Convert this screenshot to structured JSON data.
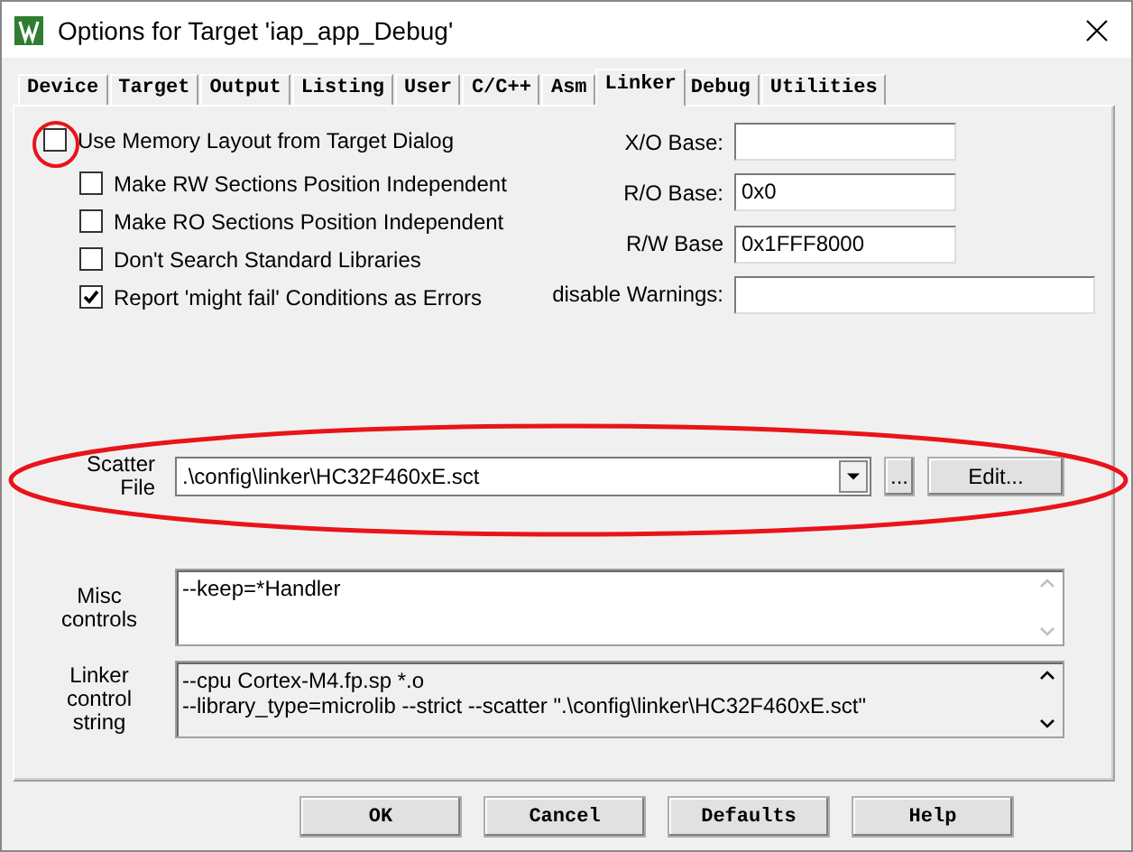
{
  "window": {
    "title": "Options for Target 'iap_app_Debug'"
  },
  "tabs": [
    {
      "label": "Device",
      "selected": false
    },
    {
      "label": "Target",
      "selected": false
    },
    {
      "label": "Output",
      "selected": false
    },
    {
      "label": "Listing",
      "selected": false
    },
    {
      "label": "User",
      "selected": false
    },
    {
      "label": "C/C++",
      "selected": false
    },
    {
      "label": "Asm",
      "selected": false
    },
    {
      "label": "Linker",
      "selected": true
    },
    {
      "label": "Debug",
      "selected": false
    },
    {
      "label": "Utilities",
      "selected": false
    }
  ],
  "checkboxes": [
    {
      "kind": "main",
      "label": "Use Memory Layout from Target Dialog",
      "checked": false
    },
    {
      "kind": "sub",
      "label": "Make RW Sections Position Independent",
      "checked": false
    },
    {
      "kind": "sub",
      "label": "Make RO Sections Position Independent",
      "checked": false
    },
    {
      "kind": "sub",
      "label": "Don't Search Standard Libraries",
      "checked": false
    },
    {
      "kind": "sub",
      "label": "Report 'might fail' Conditions as Errors",
      "checked": true
    }
  ],
  "address_fields": [
    {
      "kind": "short",
      "label": "X/O Base:"
    },
    {
      "kind": "short",
      "label": "R/O Base:",
      "value": "0x0"
    },
    {
      "kind": "short",
      "label": "R/W Base",
      "value": "0x1FFF8000"
    },
    {
      "kind": "wide",
      "label": "disable Warnings:"
    }
  ],
  "scatter_file": {
    "label": "Scatter File",
    "value": ".\\config\\linker\\HC32F460xE.sct",
    "browse_button": "...",
    "edit_button": "Edit..."
  },
  "misc_controls": {
    "label": "Misc controls",
    "value": "--keep=*Handler"
  },
  "linker_control_string": {
    "label": "Linker control string",
    "lines": [
      "--cpu Cortex-M4.fp.sp *.o",
      "--library_type=microlib --strict --scatter \".\\config\\linker\\HC32F460xE.sct\""
    ]
  },
  "buttons": [
    "OK",
    "Cancel",
    "Defaults",
    "Help"
  ],
  "annotations": [
    {
      "kind": "circle"
    },
    {
      "kind": "ellipse"
    }
  ]
}
